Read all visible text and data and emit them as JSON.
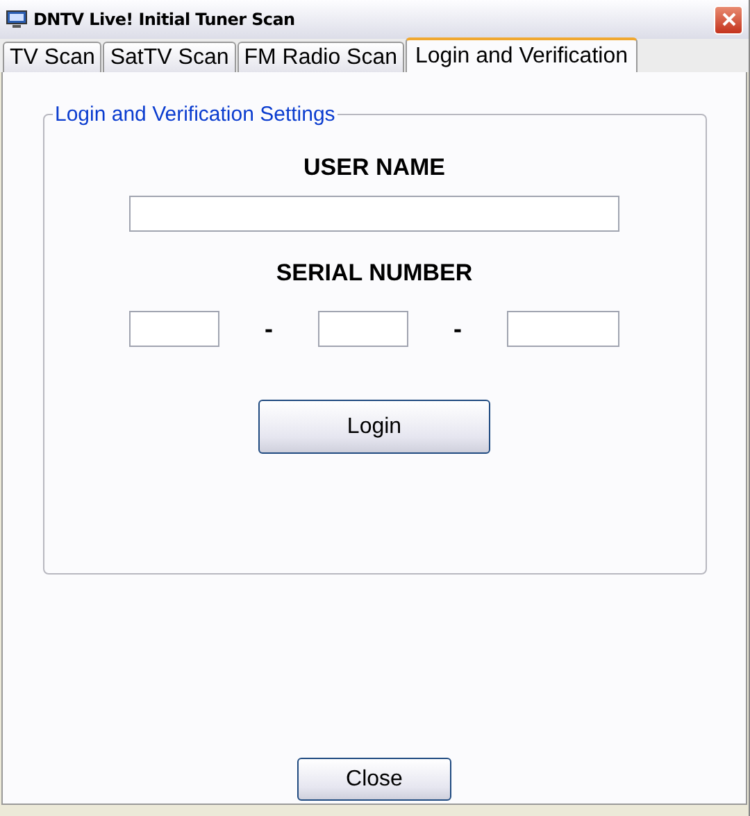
{
  "window": {
    "title": "DNTV Live! Initial Tuner Scan"
  },
  "tabs": [
    {
      "label": "TV Scan",
      "selected": false
    },
    {
      "label": "SatTV Scan",
      "selected": false
    },
    {
      "label": "FM Radio Scan",
      "selected": false
    },
    {
      "label": "Login and Verification",
      "selected": true
    }
  ],
  "group": {
    "title": "Login and Verification Settings",
    "user_name": {
      "label": "USER NAME"
    },
    "serial_number": {
      "label": "SERIAL NUMBER",
      "separators": [
        "-",
        "-"
      ]
    },
    "login_button": "Login"
  },
  "buttons": [
    "Close"
  ]
}
